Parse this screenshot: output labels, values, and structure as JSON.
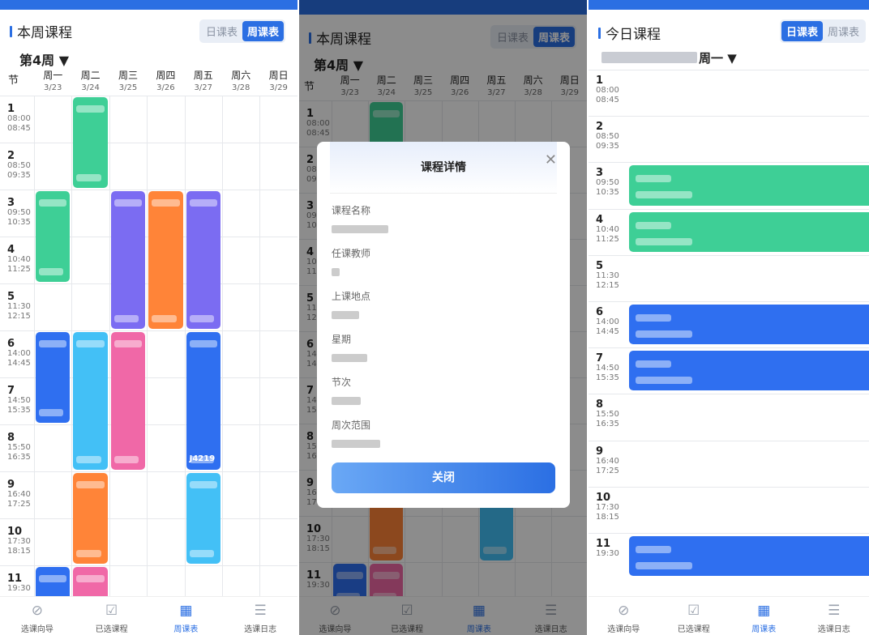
{
  "panel1": {
    "title": "本周课程",
    "toggle": [
      "日课表",
      "周课表"
    ],
    "week": "第4周 ▼",
    "col_header": "节",
    "days": [
      [
        "周一",
        "3/23"
      ],
      [
        "周二",
        "3/24"
      ],
      [
        "周三",
        "3/25"
      ],
      [
        "周四",
        "3/26"
      ],
      [
        "周五",
        "3/27"
      ],
      [
        "周六",
        "3/28"
      ],
      [
        "周日",
        "3/29"
      ]
    ],
    "periods": [
      [
        "1",
        "08:00",
        "08:45"
      ],
      [
        "2",
        "08:50",
        "09:35"
      ],
      [
        "3",
        "09:50",
        "10:35"
      ],
      [
        "4",
        "10:40",
        "11:25"
      ],
      [
        "5",
        "11:30",
        "12:15"
      ],
      [
        "6",
        "14:00",
        "14:45"
      ],
      [
        "7",
        "14:50",
        "15:35"
      ],
      [
        "8",
        "15:50",
        "16:35"
      ],
      [
        "9",
        "16:40",
        "17:25"
      ],
      [
        "10",
        "17:30",
        "18:15"
      ],
      [
        "11",
        "19:30",
        ""
      ]
    ],
    "room_label": "J4219"
  },
  "panel2": {
    "modal_title": "课程详情",
    "fields": [
      "课程名称",
      "任课教师",
      "上课地点",
      "星期",
      "节次",
      "周次范围"
    ],
    "close_label": "关闭"
  },
  "panel3": {
    "title": "今日课程",
    "toggle": [
      "日课表",
      "周课表"
    ],
    "day_label": "周一 ▼",
    "periods": [
      [
        "1",
        "08:00",
        "08:45"
      ],
      [
        "2",
        "08:50",
        "09:35"
      ],
      [
        "3",
        "09:50",
        "10:35"
      ],
      [
        "4",
        "10:40",
        "11:25"
      ],
      [
        "5",
        "11:30",
        "12:15"
      ],
      [
        "6",
        "14:00",
        "14:45"
      ],
      [
        "7",
        "14:50",
        "15:35"
      ],
      [
        "8",
        "15:50",
        "16:35"
      ],
      [
        "9",
        "16:40",
        "17:25"
      ],
      [
        "10",
        "17:30",
        "18:15"
      ],
      [
        "11",
        "19:30",
        ""
      ]
    ]
  },
  "tabs": [
    "选课向导",
    "已选课程",
    "周课表",
    "选课日志"
  ],
  "colors": {
    "green": "#3ecf96",
    "blue": "#2f6ff0",
    "purple": "#7b6cf2",
    "orange": "#ff8438",
    "pink": "#f068a7",
    "cyan": "#43c0f6",
    "accent": "#2b6fe3"
  }
}
